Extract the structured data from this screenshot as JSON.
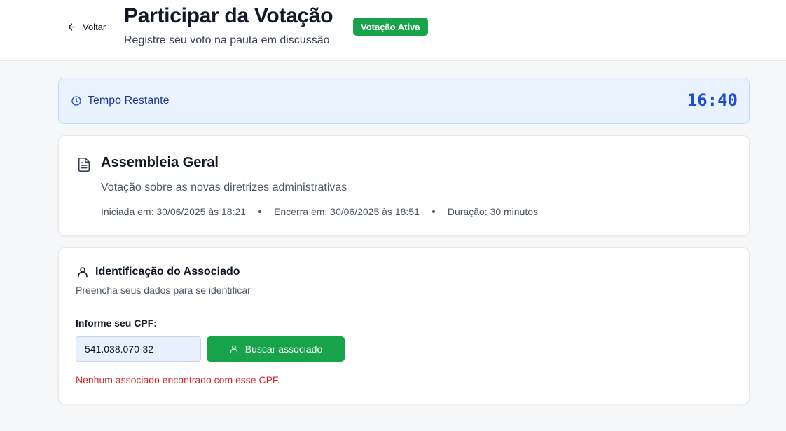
{
  "header": {
    "back_label": "Voltar",
    "title": "Participar da Votação",
    "subtitle": "Registre seu voto na pauta em discussão",
    "status_badge": "Votação Ativa"
  },
  "timer": {
    "label": "Tempo Restante",
    "value": "16:40"
  },
  "agenda": {
    "title": "Assembleia Geral",
    "description": "Votação sobre as novas diretrizes administrativas",
    "started": "Iniciada em: 30/06/2025 às 18:21",
    "ends": "Encerra em: 30/06/2025 às 18:51",
    "duration": "Duração: 30 minutos"
  },
  "identification": {
    "title": "Identificação do Associado",
    "subtitle": "Preencha seus dados para se identificar",
    "cpf_label": "Informe seu CPF:",
    "cpf_value": "541.038.070-32",
    "search_button": "Buscar associado",
    "error": "Nenhum associado encontrado com esse CPF."
  },
  "colors": {
    "accent_green": "#16a34a",
    "timer_blue": "#1d4ed8",
    "error_red": "#dc2626"
  },
  "icons": {
    "back": "arrow-left-icon",
    "timer": "clock-icon",
    "agenda": "document-icon",
    "identification": "user-icon",
    "search_button": "user-icon"
  }
}
